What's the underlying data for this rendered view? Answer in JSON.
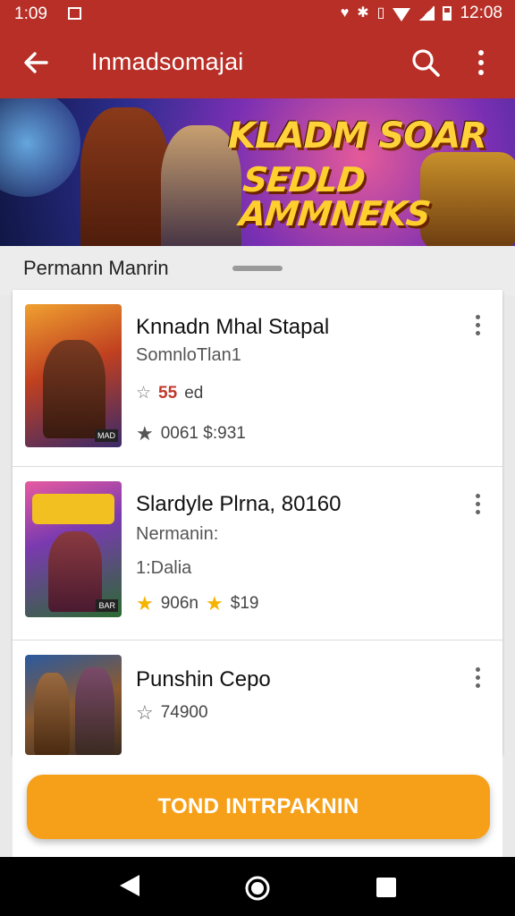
{
  "status_bar": {
    "time_left": "1:09",
    "time_right": "12:08"
  },
  "app_bar": {
    "title": "Inmadsomajai",
    "back_icon": "arrow-back-icon",
    "search_icon": "search-icon",
    "more_icon": "more-vert-icon"
  },
  "banner": {
    "line1": "KLADM SOAR",
    "line2": "SEDLD AMMNEKS"
  },
  "section": {
    "label": "Permann Manrin"
  },
  "items": [
    {
      "name": "Knnadn Mhal Stapal",
      "sub": "SomnloTlan1",
      "rating_text": "55",
      "rating_suffix": "ed",
      "price_row": "0061 $:931"
    },
    {
      "name": "Slardyle Plrna, 80160",
      "sub": "Nermanin:",
      "line3": "1:Dalia",
      "price_row": "906n",
      "price2": "$19"
    },
    {
      "name": "Punshin Cepo",
      "rating_row": "74900"
    }
  ],
  "cta": {
    "label": "TOND INTRPAKNIN"
  },
  "colors": {
    "app_bar": "#b72f27",
    "cta": "#f6a019",
    "star_gold": "#f4b400"
  }
}
